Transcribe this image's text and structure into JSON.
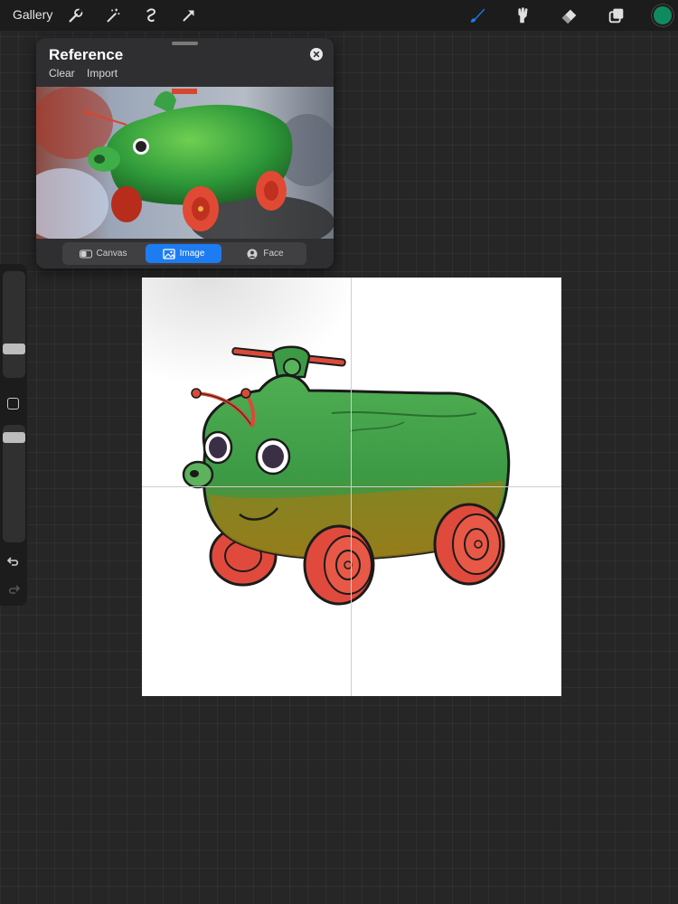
{
  "topbar": {
    "gallery_label": "Gallery",
    "left_tools": [
      "wrench-icon",
      "magic-wand-icon",
      "selection-icon",
      "transform-arrow-icon"
    ],
    "right_tools": [
      "brush-icon",
      "smudge-icon",
      "eraser-icon",
      "layers-icon"
    ],
    "active_tool": "brush-icon",
    "accent_color": "#1e7cf2",
    "current_color": "#0f8a5e"
  },
  "reference": {
    "title": "Reference",
    "clear_label": "Clear",
    "import_label": "Import",
    "tabs": [
      {
        "label": "Canvas",
        "icon": "canvas-toggle-icon"
      },
      {
        "label": "Image",
        "icon": "image-icon"
      },
      {
        "label": "Face",
        "icon": "face-icon"
      }
    ],
    "selected_tab": "Image"
  },
  "sidebar": {
    "brush_size_level": 0.25,
    "opacity_level": 0.9
  }
}
